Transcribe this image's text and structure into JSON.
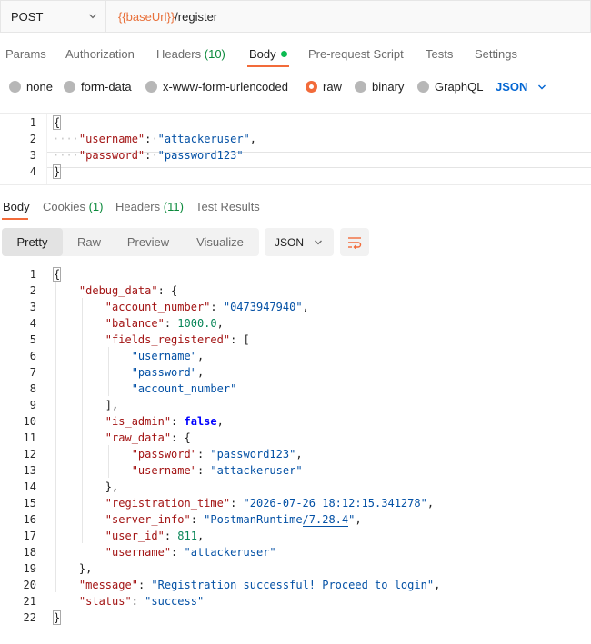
{
  "request": {
    "method": "POST",
    "url_variable": "{{baseUrl}}",
    "url_path": "/register"
  },
  "request_tabs": [
    {
      "label": "Params"
    },
    {
      "label": "Authorization"
    },
    {
      "label": "Headers",
      "count": "(10)"
    },
    {
      "label": "Body",
      "active": true
    },
    {
      "label": "Pre-request Script"
    },
    {
      "label": "Tests"
    },
    {
      "label": "Settings"
    }
  ],
  "body_modes": [
    {
      "label": "none"
    },
    {
      "label": "form-data"
    },
    {
      "label": "x-www-form-urlencoded"
    },
    {
      "label": "raw",
      "selected": true
    },
    {
      "label": "binary"
    },
    {
      "label": "GraphQL"
    }
  ],
  "body_language": "JSON",
  "request_body_lines": [
    "1",
    "2",
    "3",
    "4"
  ],
  "request_body": {
    "open": "{",
    "k1": "\"username\"",
    "v1": "\"attackeruser\"",
    "k2": "\"password\"",
    "v2": "\"password123\"",
    "close": "}"
  },
  "response_tabs": [
    {
      "label": "Body",
      "active": true
    },
    {
      "label": "Cookies",
      "count": "(1)"
    },
    {
      "label": "Headers",
      "count": "(11)"
    },
    {
      "label": "Test Results"
    }
  ],
  "view_modes": [
    "Pretty",
    "Raw",
    "Preview",
    "Visualize"
  ],
  "response_format": "JSON",
  "response_line_numbers": [
    "1",
    "2",
    "3",
    "4",
    "5",
    "6",
    "7",
    "8",
    "9",
    "10",
    "11",
    "12",
    "13",
    "14",
    "15",
    "16",
    "17",
    "18",
    "19",
    "20",
    "21",
    "22"
  ],
  "response_body": {
    "debug_data_key": "\"debug_data\"",
    "account_number_key": "\"account_number\"",
    "account_number_value": "\"0473947940\"",
    "balance_key": "\"balance\"",
    "balance_value": "1000.0",
    "fields_registered_key": "\"fields_registered\"",
    "fields_registered": [
      "\"username\"",
      "\"password\"",
      "\"account_number\""
    ],
    "is_admin_key": "\"is_admin\"",
    "is_admin_value": "false",
    "raw_data_key": "\"raw_data\"",
    "raw_password_key": "\"password\"",
    "raw_password_value": "\"password123\"",
    "raw_username_key": "\"username\"",
    "raw_username_value": "\"attackeruser\"",
    "registration_time_key": "\"registration_time\"",
    "registration_time_value": "\"2026-07-26 18:12:15.341278\"",
    "server_info_key": "\"server_info\"",
    "server_info_value_a": "\"PostmanRuntime",
    "server_info_value_b": "/7.28.4",
    "server_info_value_c": "\"",
    "user_id_key": "\"user_id\"",
    "user_id_value": "811",
    "username_key": "\"username\"",
    "username_value": "\"attackeruser\"",
    "message_key": "\"message\"",
    "message_value": "\"Registration successful! Proceed to login\"",
    "status_key": "\"status\"",
    "status_value": "\"success\""
  },
  "icons": {
    "method_dropdown": "chevron-down-icon",
    "language_dropdown": "chevron-down-icon",
    "format_dropdown": "chevron-down-icon",
    "wrap": "wrap-lines-icon"
  },
  "colors": {
    "accent": "#f26b3a",
    "variable": "#e8703a",
    "count": "#0c8a3c",
    "link_blue": "#0265d2",
    "json_key": "#a31515",
    "json_string": "#0451a5",
    "json_number": "#098658",
    "json_boolean": "#0000ff"
  }
}
